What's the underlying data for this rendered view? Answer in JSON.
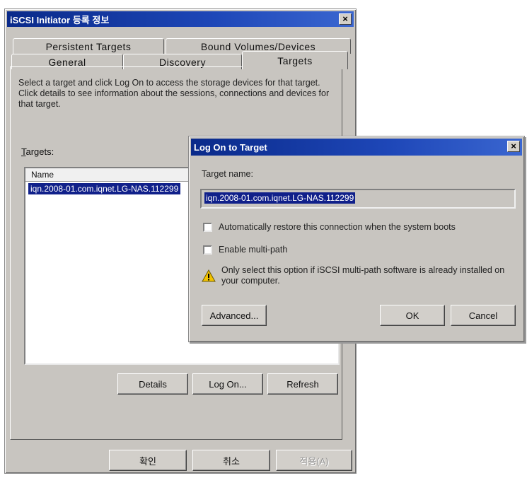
{
  "main": {
    "title": "iSCSI Initiator 등록 정보",
    "close": "×",
    "tabs": {
      "persistent": "Persistent Targets",
      "bound": "Bound Volumes/Devices",
      "general": "General",
      "discovery": "Discovery",
      "targets": "Targets"
    },
    "description": "Select a target and click Log On to access the storage devices for that target. Click details to see information about the sessions, connections and devices for that target.",
    "targets_label_u": "T",
    "targets_label_rest": "argets:",
    "list_header": "Name",
    "list_row": "iqn.2008-01.com.iqnet.LG-NAS.112299",
    "buttons": {
      "details": "Details",
      "logon": "Log On...",
      "refresh": "Refresh"
    },
    "footer": {
      "ok": "확인",
      "cancel": "취소",
      "apply": "적용(A)"
    }
  },
  "logon_dialog": {
    "title": "Log On to Target",
    "close": "×",
    "target_name_label": "Target name:",
    "target_name_value": "iqn.2008-01.com.iqnet.LG-NAS.112299",
    "auto_restore": "Automatically restore this connection when the system boots",
    "multipath": "Enable multi-path",
    "warning": "Only select this option if iSCSI multi-path software is already installed on your computer.",
    "advanced": "Advanced...",
    "ok": "OK",
    "cancel": "Cancel"
  },
  "colors": {
    "titlebar": "#0a2a8a",
    "face": "#c8c5c0",
    "selection": "#10208a"
  }
}
